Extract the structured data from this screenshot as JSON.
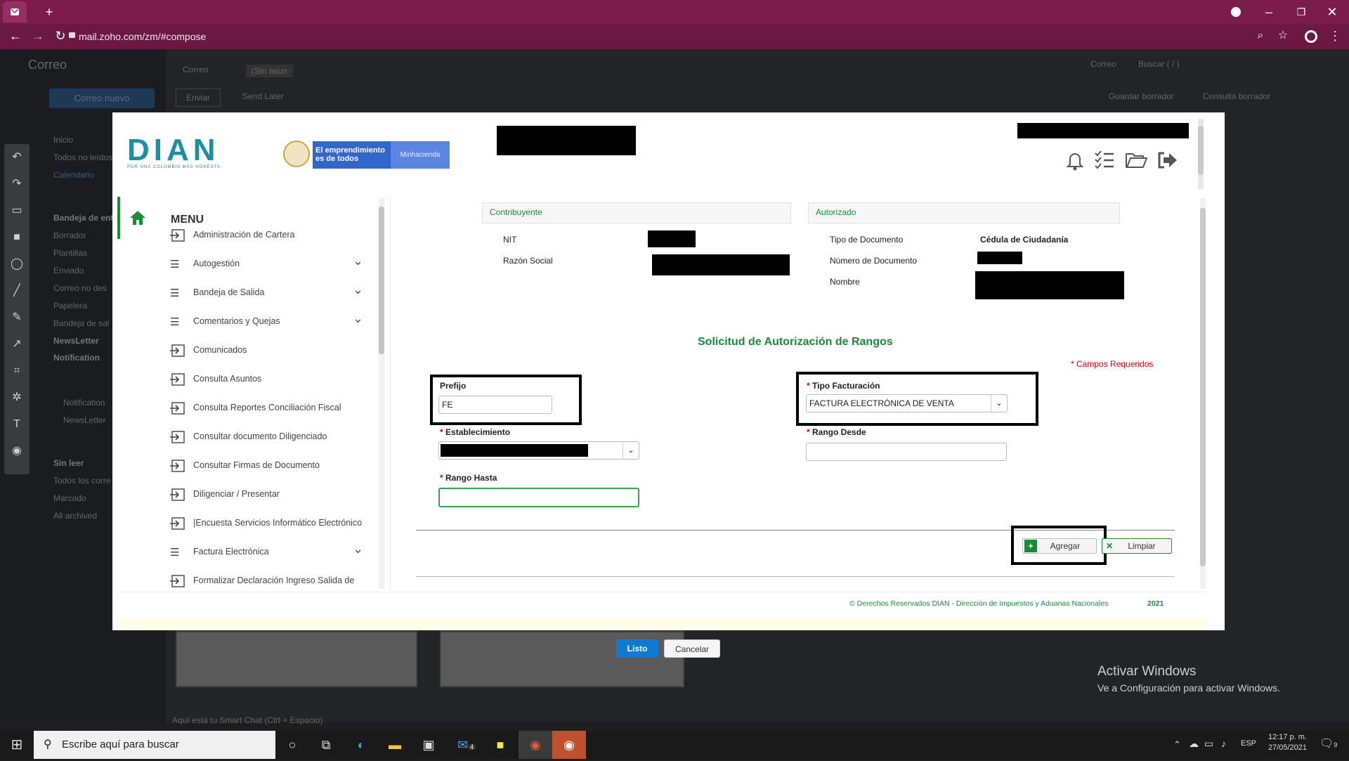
{
  "browser": {
    "url": "mail.zoho.com/zm/#compose"
  },
  "zoho": {
    "app_title": "Correo",
    "tabs": [
      "Correo",
      "(Sin asun"
    ],
    "new_mail": "Correo nuevo",
    "send": "Enviar",
    "send_later": "Send Later",
    "search_scope": "Correo",
    "search_placeholder": "Buscar ( / )",
    "save_draft": "Guardar borrador",
    "draft_hint": "Consulta borrador",
    "folders": [
      "Inicio",
      "Todos no leídos",
      "Calendario",
      "Bandeja de ent",
      "Borrador",
      "Plantillas",
      "Enviado",
      "Correo no des",
      "Papelera",
      "Bandeja de sal",
      "NewsLetter",
      "Notification"
    ],
    "tags": [
      "Notification",
      "NewsLetter"
    ],
    "views": [
      "Sin leer",
      "Todos los corre",
      "Marcado",
      "All archived"
    ],
    "bottom_hint": "Aquí está tu Smart Chat (Ctrl + Espacio)"
  },
  "modal": {
    "done": "Listo",
    "cancel": "Cancelar"
  },
  "dian": {
    "logo_text": "DIAN",
    "logo_tagline": "POR UNA COLOMBIA MÁS HONESTA",
    "gov_banner": "El emprendimiento es de todos",
    "gov_ministry": "Minhacienda",
    "menu_title": "MENU",
    "menu_items": [
      {
        "label": "Administración de Cartera",
        "expandable": false
      },
      {
        "label": "Autogestión",
        "expandable": true
      },
      {
        "label": "Bandeja de Salida",
        "expandable": true
      },
      {
        "label": "Comentarios y Quejas",
        "expandable": true
      },
      {
        "label": "Comunicados",
        "expandable": false
      },
      {
        "label": "Consulta Asuntos",
        "expandable": false
      },
      {
        "label": "Consulta Reportes Conciliación Fiscal",
        "expandable": false
      },
      {
        "label": "Consultar documento Diligenciado",
        "expandable": false
      },
      {
        "label": "Consultar Firmas de Documento",
        "expandable": false
      },
      {
        "label": "Diligenciar / Presentar",
        "expandable": false
      },
      {
        "label": "|Encuesta Servicios Informático Electrónico",
        "expandable": false
      },
      {
        "label": "Factura Electrónica",
        "expandable": true
      },
      {
        "label": "Formalizar Declaración Ingreso Salida de",
        "expandable": false
      }
    ],
    "contribuyente": {
      "title": "Contribuyente",
      "nit_label": "NIT",
      "razon_label": "Razón Social"
    },
    "autorizado": {
      "title": "Autorizado",
      "tipo_doc_label": "Tipo de Documento",
      "tipo_doc_value": "Cédula de Ciudadanía",
      "num_doc_label": "Número de Documento",
      "nombre_label": "Nombre"
    },
    "form": {
      "title": "Solicitud de Autorización de Rangos",
      "required_note": "* Campos Requeridos",
      "prefijo_label": "Prefijo",
      "prefijo_value": "FE",
      "tipo_fact_label": "Tipo Facturación",
      "tipo_fact_value": "FACTURA ELECTRÓNICA DE VENTA",
      "establecimiento_label": "Establecimiento",
      "rango_desde_label": "Rango Desde",
      "rango_hasta_label": "Rango Hasta",
      "rango_hasta_value": "",
      "add_button": "Agregar",
      "clear_button": "Limpiar"
    },
    "footer": "© Derechos Reservados DIAN - Dirección de Impuestos y Aduanas Nacionales",
    "footer_year": "2021"
  },
  "overlay": {
    "activate_title": "Activar Windows",
    "activate_sub": "Ve a Configuración para activar Windows."
  },
  "taskbar": {
    "search_placeholder": "Escribe aquí para buscar",
    "language": "ESP",
    "time": "12:17 p. m.",
    "date": "27/05/2021",
    "notif_count": "9",
    "mail_badge": "4"
  },
  "colors": {
    "chrome": "#7b1c4a",
    "dian_green": "#1b8a3a",
    "dian_teal": "#1f8fa0",
    "primary_blue": "#0e7ad1"
  }
}
